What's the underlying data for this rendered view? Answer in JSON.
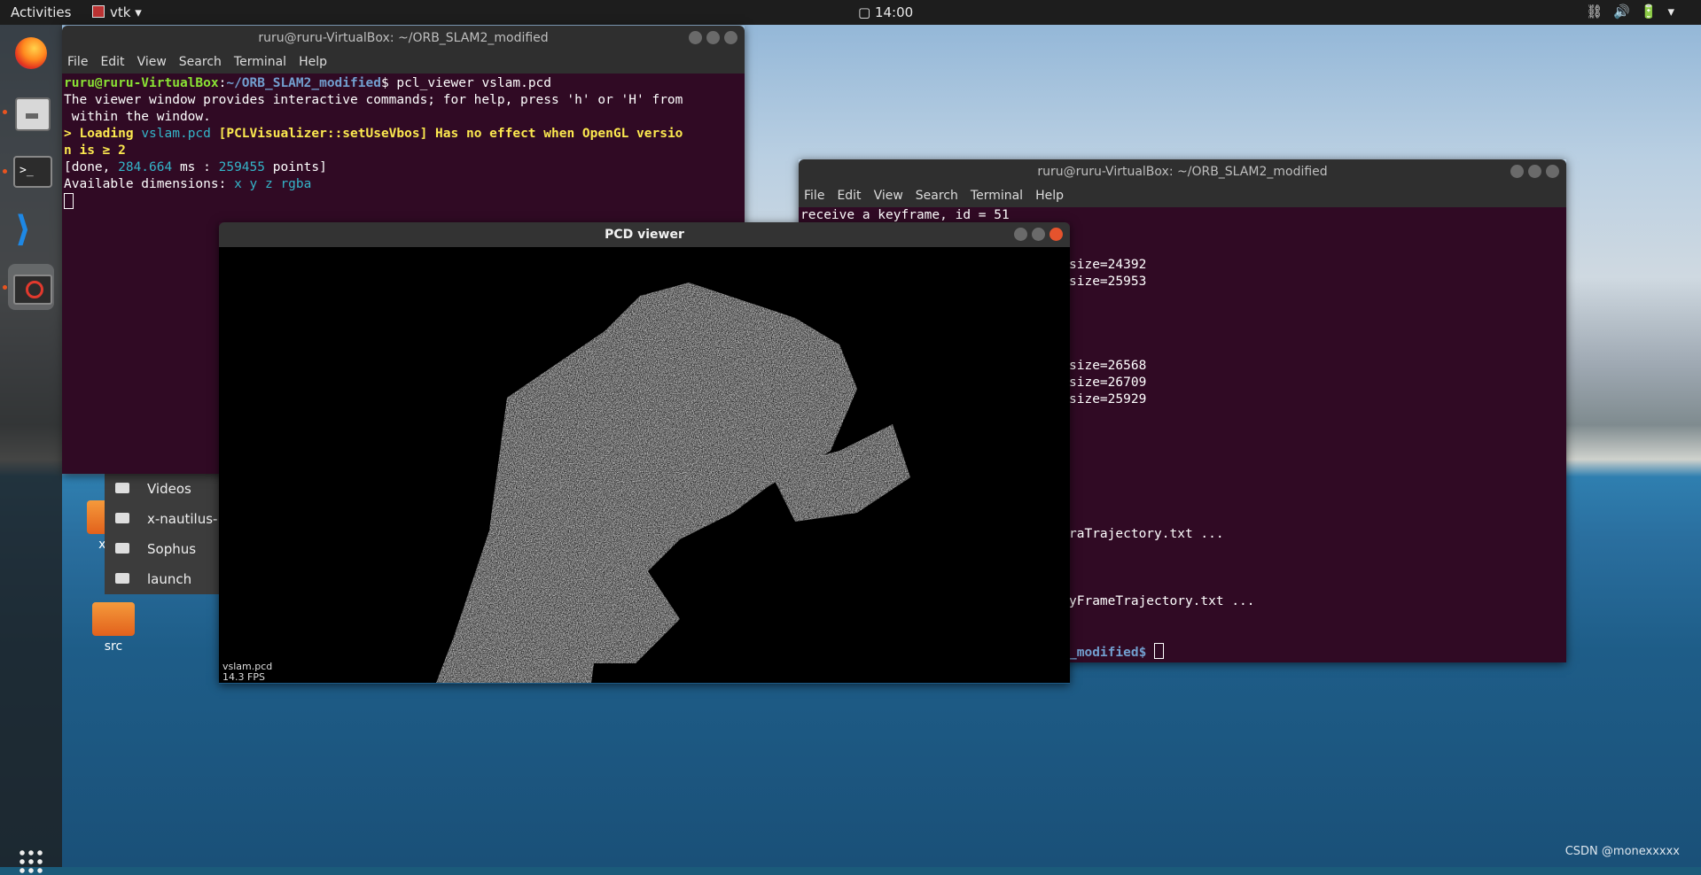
{
  "topbar": {
    "activities": "Activities",
    "app_name": "vtk",
    "clock": "14:00"
  },
  "dock": {
    "items": [
      {
        "name": "firefox-icon"
      },
      {
        "name": "files-icon"
      },
      {
        "name": "terminal-icon"
      },
      {
        "name": "vscode-icon"
      },
      {
        "name": "blocked-app-icon"
      }
    ],
    "terminal_glyph": ">_",
    "vscode_glyph": "⟩"
  },
  "terminal1": {
    "title": "ruru@ruru-VirtualBox: ~/ORB_SLAM2_modified",
    "menu": [
      "File",
      "Edit",
      "View",
      "Search",
      "Terminal",
      "Help"
    ],
    "prompt_user": "ruru@ruru-VirtualBox",
    "prompt_path": "~/ORB_SLAM2_modified",
    "command": "$ pcl_viewer vslam.pcd",
    "line2": "The viewer window provides interactive commands; for help, press 'h' or 'H' from",
    "line3": " within the window.",
    "line4_prefix": "> Loading ",
    "line4_file": "vslam.pcd",
    "line4_warn": " [PCLVisualizer::setUseVbos] Has no effect when OpenGL versio",
    "line5": "n is ≥ 2",
    "line6_a": "[done, ",
    "line6_ms": "284.664",
    "line6_b": " ms : ",
    "line6_pts": "259455",
    "line6_c": " points]",
    "line7_a": "Available dimensions: ",
    "line7_dims": "x y z rgba"
  },
  "terminal2": {
    "title": "ruru@ruru-VirtualBox: ~/ORB_SLAM2_modified",
    "menu": [
      "File",
      "Edit",
      "View",
      "Search",
      "Terminal",
      "Help"
    ],
    "lines": [
      "receive a keyframe, id = 51",
      "size=24392",
      "size=25953",
      "size=26568",
      "size=26709",
      "size=25929",
      "raTrajectory.txt ...",
      "yFrameTrajectory.txt ...",
      "_modified$"
    ]
  },
  "file_list": {
    "items": [
      "Videos",
      "x-nautilus-",
      "Sophus",
      "launch"
    ]
  },
  "desktop": {
    "icons": [
      "xfe",
      "src"
    ]
  },
  "pcd_viewer": {
    "title": "PCD viewer",
    "overlay_name": "vslam.pcd",
    "overlay_fps": "14.3 FPS"
  },
  "watermark": "CSDN @monexxxxx"
}
